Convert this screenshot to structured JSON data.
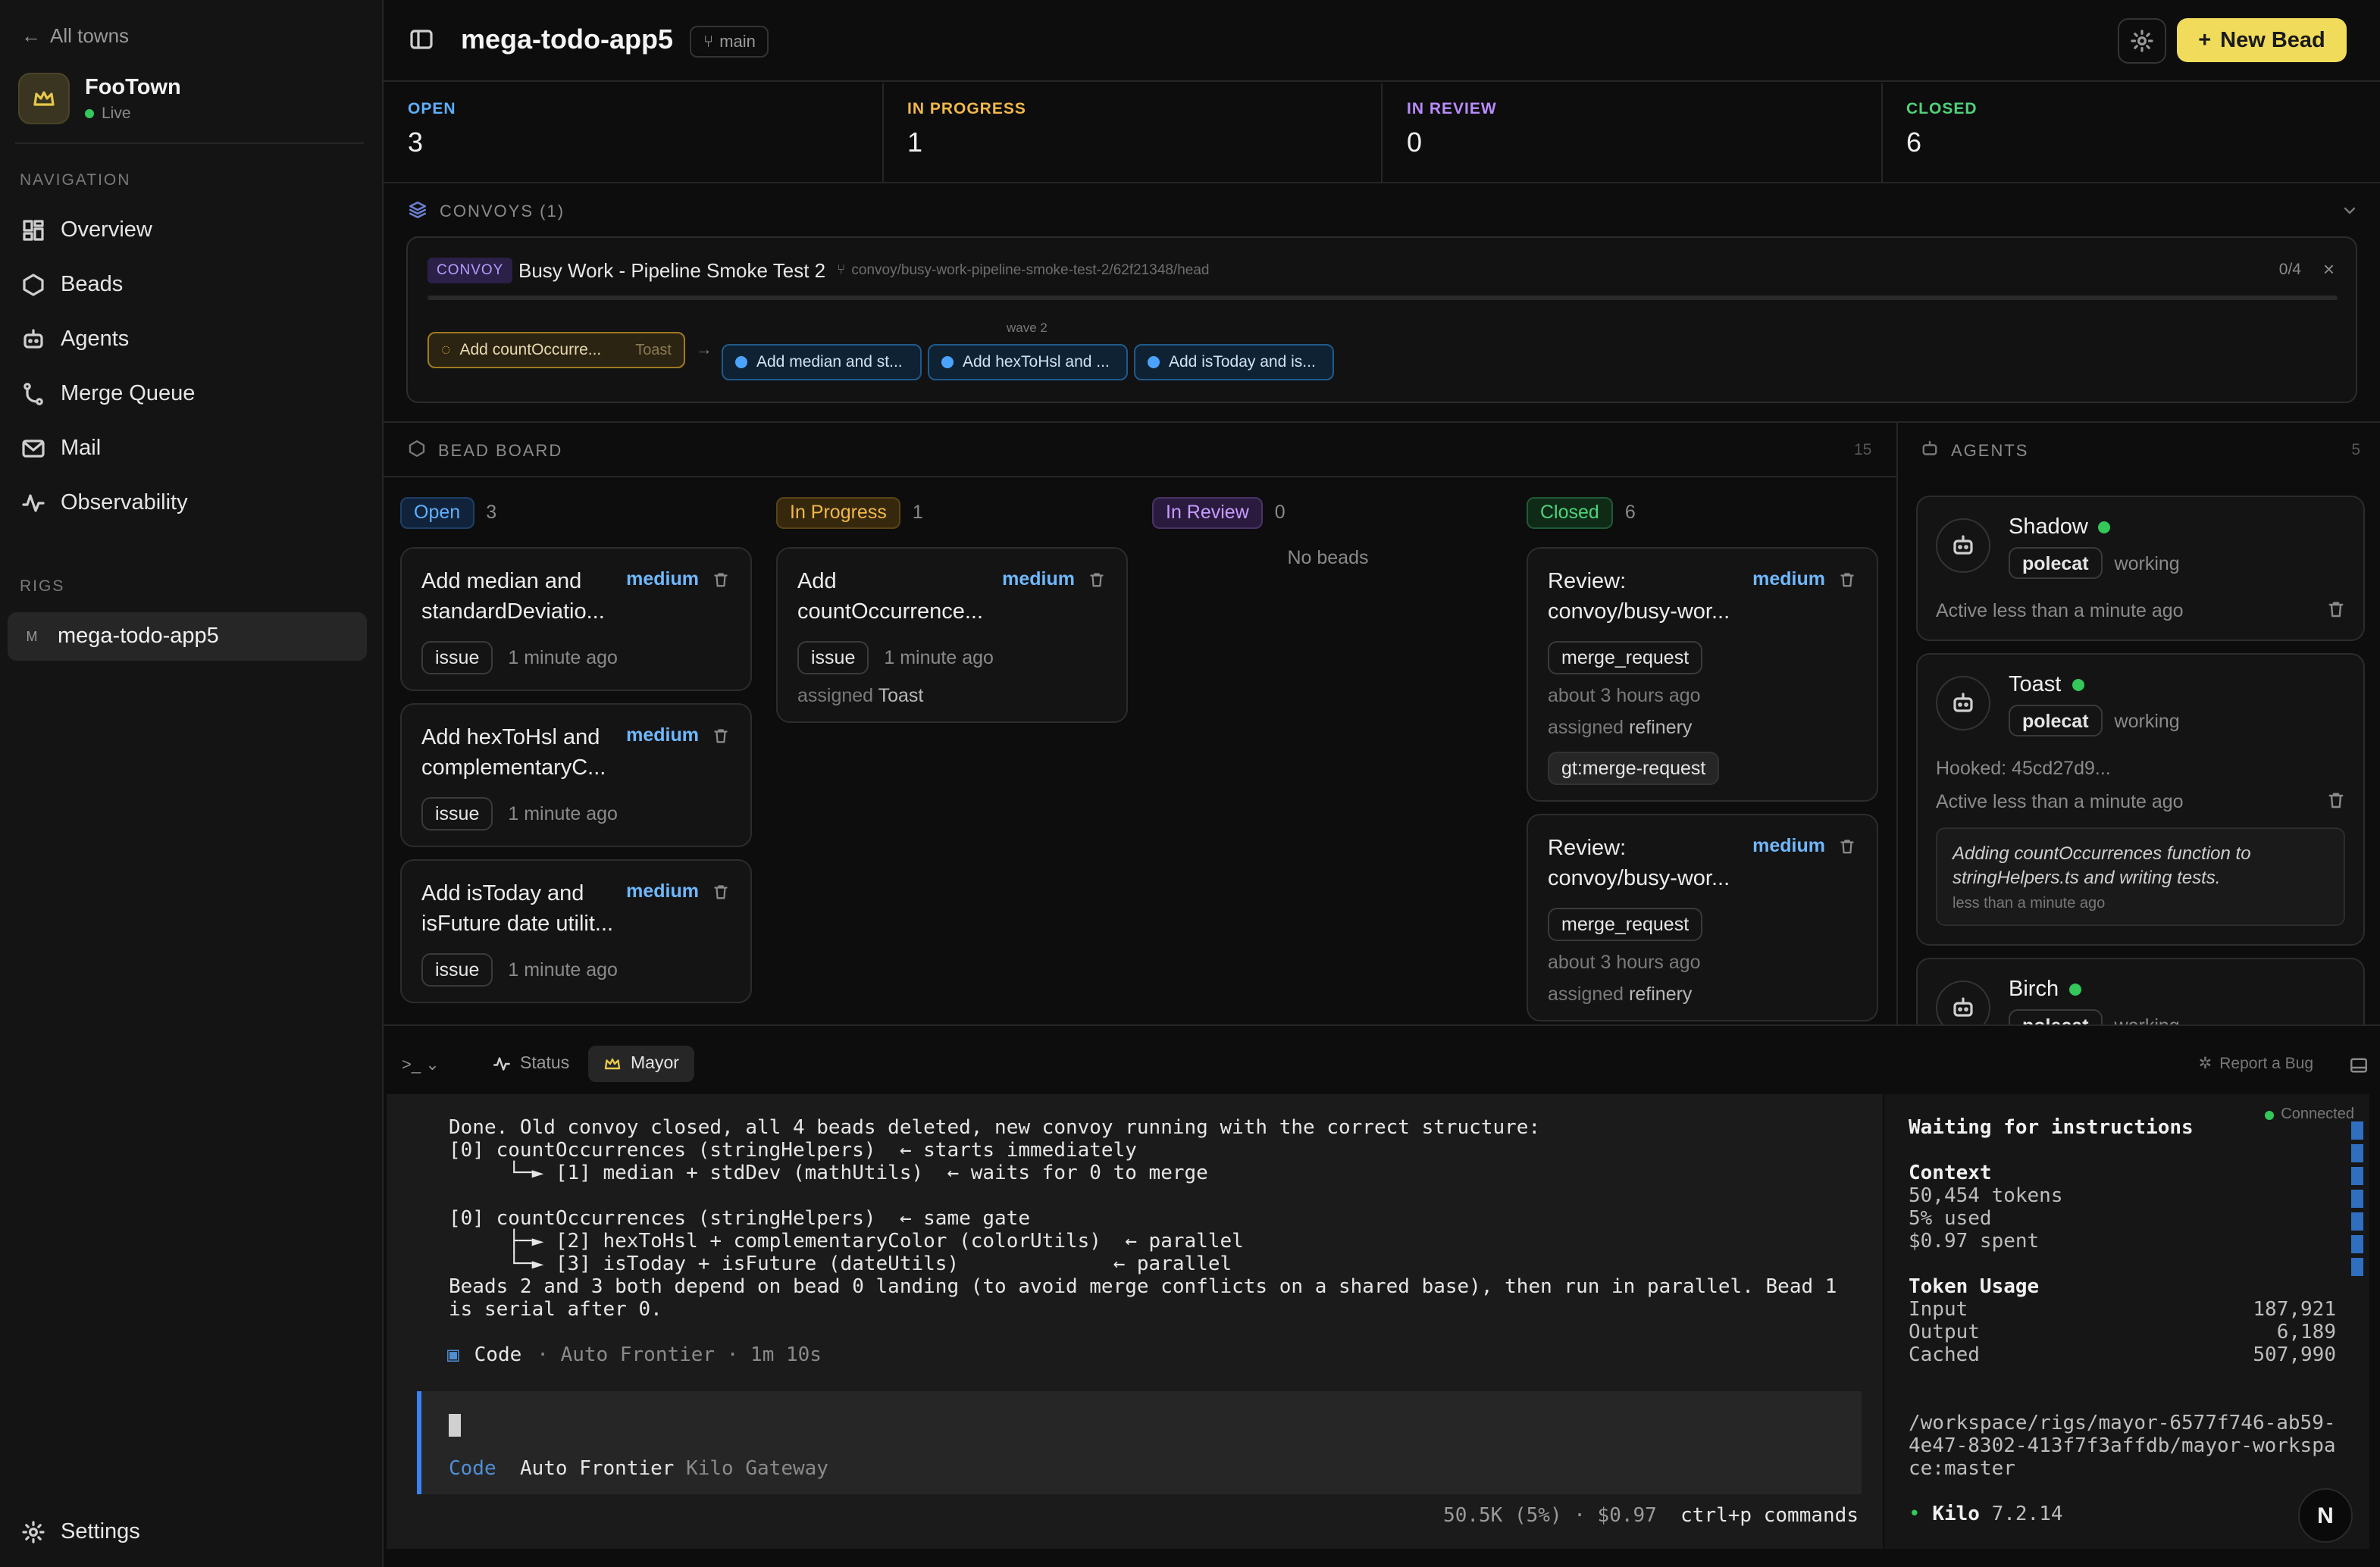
{
  "sidebar": {
    "back_label": "All towns",
    "town_name": "FooTown",
    "town_status": "Live",
    "nav_section": "NAVIGATION",
    "nav": [
      {
        "label": "Overview",
        "icon": "grid-icon"
      },
      {
        "label": "Beads",
        "icon": "hexagon-icon"
      },
      {
        "label": "Agents",
        "icon": "robot-icon"
      },
      {
        "label": "Merge Queue",
        "icon": "git-merge-icon"
      },
      {
        "label": "Mail",
        "icon": "mail-icon"
      },
      {
        "label": "Observability",
        "icon": "activity-icon"
      }
    ],
    "rigs_section": "RIGS",
    "rig_badge": "M",
    "rig_name": "mega-todo-app5",
    "settings_label": "Settings"
  },
  "header": {
    "title": "mega-todo-app5",
    "branch": "main",
    "new_bead_label": "New Bead"
  },
  "stats": [
    {
      "label": "OPEN",
      "value": "3",
      "color": "#5fb0ff"
    },
    {
      "label": "IN PROGRESS",
      "value": "1",
      "color": "#f2b84a"
    },
    {
      "label": "IN REVIEW",
      "value": "0",
      "color": "#b98cff"
    },
    {
      "label": "CLOSED",
      "value": "6",
      "color": "#4fd27a"
    }
  ],
  "convoys": {
    "heading": "CONVOYS (1)",
    "tag": "CONVOY",
    "name": "Busy Work - Pipeline Smoke Test 2",
    "path": "convoy/busy-work-pipeline-smoke-test-2/62f21348/head",
    "count": "0/4",
    "progress": 0,
    "active_step": {
      "label": "Add countOccurre...",
      "agent": "Toast"
    },
    "wave_label": "wave 2",
    "queued_steps": [
      "Add median and st...",
      "Add hexToHsl and ...",
      "Add isToday and is..."
    ]
  },
  "board": {
    "heading": "BEAD BOARD",
    "count": "15",
    "columns": [
      {
        "label": "Open",
        "count": "3",
        "cards": [
          {
            "title": "Add median and standardDeviatio...",
            "priority": "medium",
            "type": "issue",
            "time": "1 minute ago"
          },
          {
            "title": "Add hexToHsl and complementaryC...",
            "priority": "medium",
            "type": "issue",
            "time": "1 minute ago"
          },
          {
            "title": "Add isToday and isFuture date utilit...",
            "priority": "medium",
            "type": "issue",
            "time": "1 minute ago"
          }
        ]
      },
      {
        "label": "In Progress",
        "count": "1",
        "cards": [
          {
            "title": "Add countOccurrence...",
            "priority": "medium",
            "type": "issue",
            "time": "1 minute ago",
            "assigned_prefix": "assigned",
            "assigned": "Toast"
          }
        ]
      },
      {
        "label": "In Review",
        "count": "0",
        "empty": "No beads"
      },
      {
        "label": "Closed",
        "count": "6",
        "cards": [
          {
            "title": "Review: convoy/busy-wor...",
            "priority": "medium",
            "type": "merge_request",
            "time": "about 3 hours ago",
            "assigned_prefix": "assigned",
            "assigned": "refinery",
            "label": "gt:merge-request"
          },
          {
            "title": "Review: convoy/busy-wor...",
            "priority": "medium",
            "type": "merge_request",
            "time": "about 3 hours ago",
            "assigned_prefix": "assigned",
            "assigned": "refinery"
          }
        ]
      }
    ]
  },
  "agents": {
    "heading": "AGENTS",
    "count": "5",
    "list": [
      {
        "name": "Shadow",
        "role": "polecat",
        "state": "working",
        "activity": "Active less than a minute ago"
      },
      {
        "name": "Toast",
        "role": "polecat",
        "state": "working",
        "hooked": "Hooked: 45cd27d9...",
        "activity": "Active less than a minute ago",
        "message": "Adding countOccurrences function to stringHelpers.ts and writing tests.",
        "message_time": "less than a minute ago"
      },
      {
        "name": "Birch",
        "role": "polecat",
        "state": "working"
      }
    ]
  },
  "terminal": {
    "tabs": [
      {
        "label": "Status",
        "icon": "activity-icon"
      },
      {
        "label": "Mayor",
        "icon": "crown-icon"
      }
    ],
    "report_label": "Report a Bug",
    "output": "Done. Old convoy closed, all 4 beads deleted, new convoy running with the correct structure:\n[0] countOccurrences (stringHelpers)  ← starts immediately\n     └─► [1] median + stdDev (mathUtils)  ← waits for 0 to merge\n\n[0] countOccurrences (stringHelpers)  ← same gate\n     ├─► [2] hexToHsl + complementaryColor (colorUtils)  ← parallel\n     └─► [3] isToday + isFuture (dateUtils)             ← parallel\nBeads 2 and 3 both depend on bead 0 landing (to avoid merge conflicts on a shared base), then run in parallel. Bead 1\nis serial after 0.",
    "code_line": {
      "mode": "Code",
      "model": "· Auto Frontier · 1m 10s"
    },
    "input_line": {
      "mode": "Code",
      "model": "Auto Frontier",
      "provider": "Kilo Gateway"
    },
    "footer": {
      "usage": "50.5K (5%) · $0.97",
      "shortcut": "ctrl+p",
      "shortcut_label": "commands"
    }
  },
  "side_panel": {
    "connected": "Connected",
    "waiting": "Waiting for instructions",
    "context_heading": "Context",
    "context_lines": [
      "50,454 tokens",
      "5% used",
      "$0.97 spent"
    ],
    "token_heading": "Token Usage",
    "tokens": [
      {
        "label": "Input",
        "value": "187,921"
      },
      {
        "label": "Output",
        "value": "6,189"
      },
      {
        "label": "Cached",
        "value": "507,990"
      }
    ],
    "workspace": "/workspace/rigs/mayor-6577f746-ab59-4e47-8302-413f7f3affdb/mayor-workspace:master",
    "version_name": "Kilo",
    "version": "7.2.14"
  },
  "badge": "N"
}
